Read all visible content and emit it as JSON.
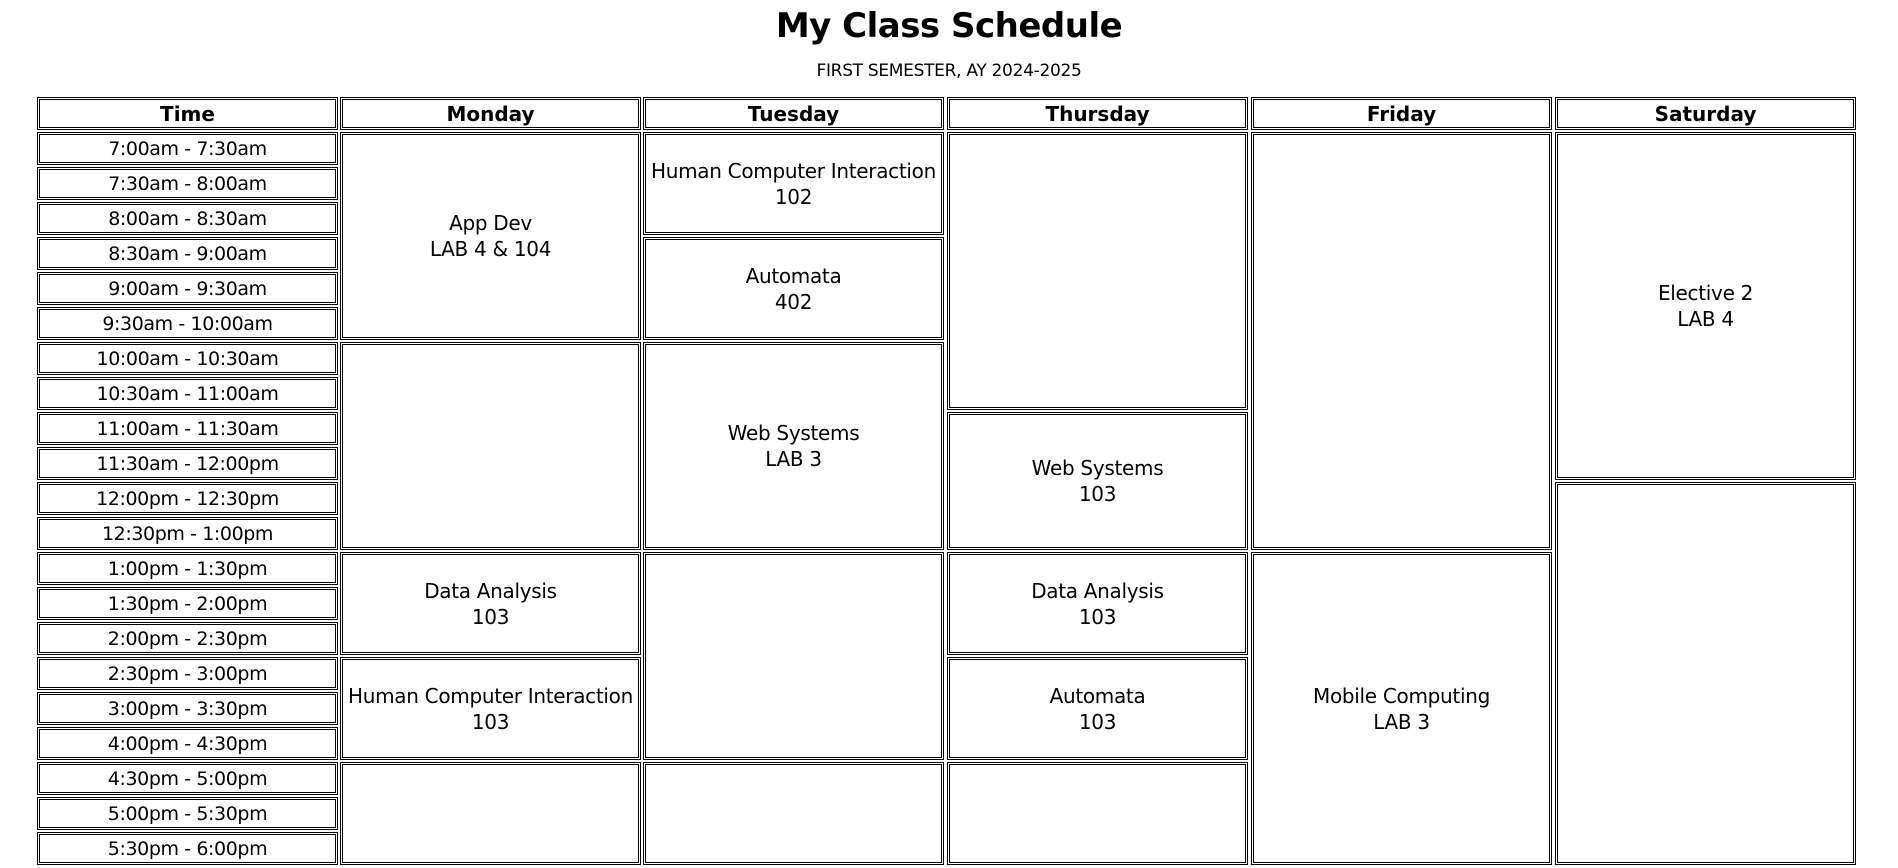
{
  "header": {
    "title": "My Class Schedule",
    "subtitle": "FIRST SEMESTER, AY 2024-2025"
  },
  "columns": [
    "Time",
    "Monday",
    "Tuesday",
    "Thursday",
    "Friday",
    "Saturday"
  ],
  "time_slots": [
    "7:00am - 7:30am",
    "7:30am - 8:00am",
    "8:00am - 8:30am",
    "8:30am - 9:00am",
    "9:00am - 9:30am",
    "9:30am - 10:00am",
    "10:00am - 10:30am",
    "10:30am - 11:00am",
    "11:00am - 11:30am",
    "11:30am - 12:00pm",
    "12:00pm - 12:30pm",
    "12:30pm - 1:00pm",
    "1:00pm - 1:30pm",
    "1:30pm - 2:00pm",
    "2:00pm - 2:30pm",
    "2:30pm - 3:00pm",
    "3:00pm - 3:30pm",
    "4:00pm - 4:30pm",
    "4:30pm - 5:00pm",
    "5:00pm - 5:30pm",
    "5:30pm - 6:00pm"
  ],
  "days": [
    {
      "day": "Monday",
      "blocks": [
        {
          "start": 0,
          "span": 6,
          "subject": "App Dev",
          "room": "LAB 4 & 104"
        },
        {
          "start": 6,
          "span": 6,
          "subject": "",
          "room": ""
        },
        {
          "start": 12,
          "span": 3,
          "subject": "Data Analysis",
          "room": "103"
        },
        {
          "start": 15,
          "span": 3,
          "subject": "Human Computer Interaction",
          "room": "103"
        },
        {
          "start": 18,
          "span": 3,
          "subject": "",
          "room": ""
        }
      ]
    },
    {
      "day": "Tuesday",
      "blocks": [
        {
          "start": 0,
          "span": 3,
          "subject": "Human Computer Interaction",
          "room": "102"
        },
        {
          "start": 3,
          "span": 3,
          "subject": "Automata",
          "room": "402"
        },
        {
          "start": 6,
          "span": 6,
          "subject": "Web Systems",
          "room": "LAB 3"
        },
        {
          "start": 12,
          "span": 6,
          "subject": "",
          "room": ""
        },
        {
          "start": 18,
          "span": 3,
          "subject": "",
          "room": ""
        }
      ]
    },
    {
      "day": "Thursday",
      "blocks": [
        {
          "start": 0,
          "span": 8,
          "subject": "",
          "room": ""
        },
        {
          "start": 8,
          "span": 4,
          "subject": "Web Systems",
          "room": "103"
        },
        {
          "start": 12,
          "span": 3,
          "subject": "Data Analysis",
          "room": "103"
        },
        {
          "start": 15,
          "span": 3,
          "subject": "Automata",
          "room": "103"
        },
        {
          "start": 18,
          "span": 3,
          "subject": "",
          "room": ""
        }
      ]
    },
    {
      "day": "Friday",
      "blocks": [
        {
          "start": 0,
          "span": 12,
          "subject": "",
          "room": ""
        },
        {
          "start": 12,
          "span": 9,
          "subject": "Mobile Computing",
          "room": "LAB 3"
        }
      ]
    },
    {
      "day": "Saturday",
      "blocks": [
        {
          "start": 0,
          "span": 10,
          "subject": "Elective 2",
          "room": "LAB 4"
        },
        {
          "start": 10,
          "span": 11,
          "subject": "",
          "room": ""
        }
      ]
    }
  ]
}
